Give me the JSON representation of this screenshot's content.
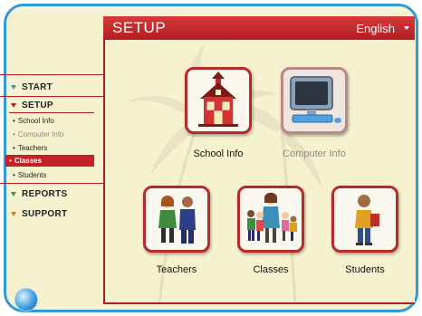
{
  "header": {
    "title": "SETUP",
    "language": "English"
  },
  "nav": {
    "start": "START",
    "setup": "SETUP",
    "setup_items": [
      "School Info",
      "Computer Info",
      "Teachers",
      "Classes",
      "Students"
    ],
    "reports": "REPORTS",
    "support": "SUPPORT",
    "active_item": "Classes"
  },
  "tiles": [
    {
      "label": "School Info",
      "icon": "schoolhouse-icon",
      "enabled": true
    },
    {
      "label": "Computer Info",
      "icon": "computer-icon",
      "enabled": false
    },
    {
      "label": "Teachers",
      "icon": "teachers-icon",
      "enabled": true
    },
    {
      "label": "Classes",
      "icon": "class-group-icon",
      "enabled": true
    },
    {
      "label": "Students",
      "icon": "student-icon",
      "enabled": true
    }
  ],
  "colors": {
    "accent_red": "#b41d22",
    "frame_blue": "#2f9ad6",
    "background": "#f6f2cf"
  }
}
